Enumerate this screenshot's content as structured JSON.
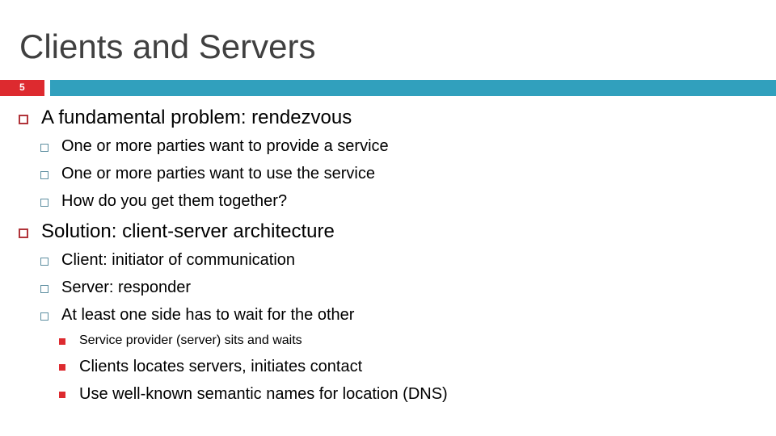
{
  "slide": {
    "title": "Clients and Servers",
    "number": "5",
    "colors": {
      "title": "#404040",
      "number_bar": "#dd2a2f",
      "accent_bar": "#31a0bd",
      "bullet_level1": "#b1343a",
      "bullet_level2": "#5d8ea0",
      "bullet_level3": "#dd2a2f"
    },
    "bullets": [
      {
        "text": "A fundamental problem: rendezvous",
        "children": [
          {
            "text": "One or more parties want to provide a service"
          },
          {
            "text": "One or more parties want to use the service"
          },
          {
            "text": "How do you get them together?"
          }
        ]
      },
      {
        "text": "Solution:  client-server architecture",
        "children": [
          {
            "text": "Client: initiator of communication"
          },
          {
            "text": "Server: responder"
          },
          {
            "text": "At least one side has to wait for the other",
            "children": [
              {
                "text": "Service provider (server) sits and waits"
              },
              {
                "text": "Clients locates servers, initiates contact"
              },
              {
                "text": "Use well-known semantic names for location (DNS)"
              }
            ]
          }
        ]
      }
    ]
  }
}
